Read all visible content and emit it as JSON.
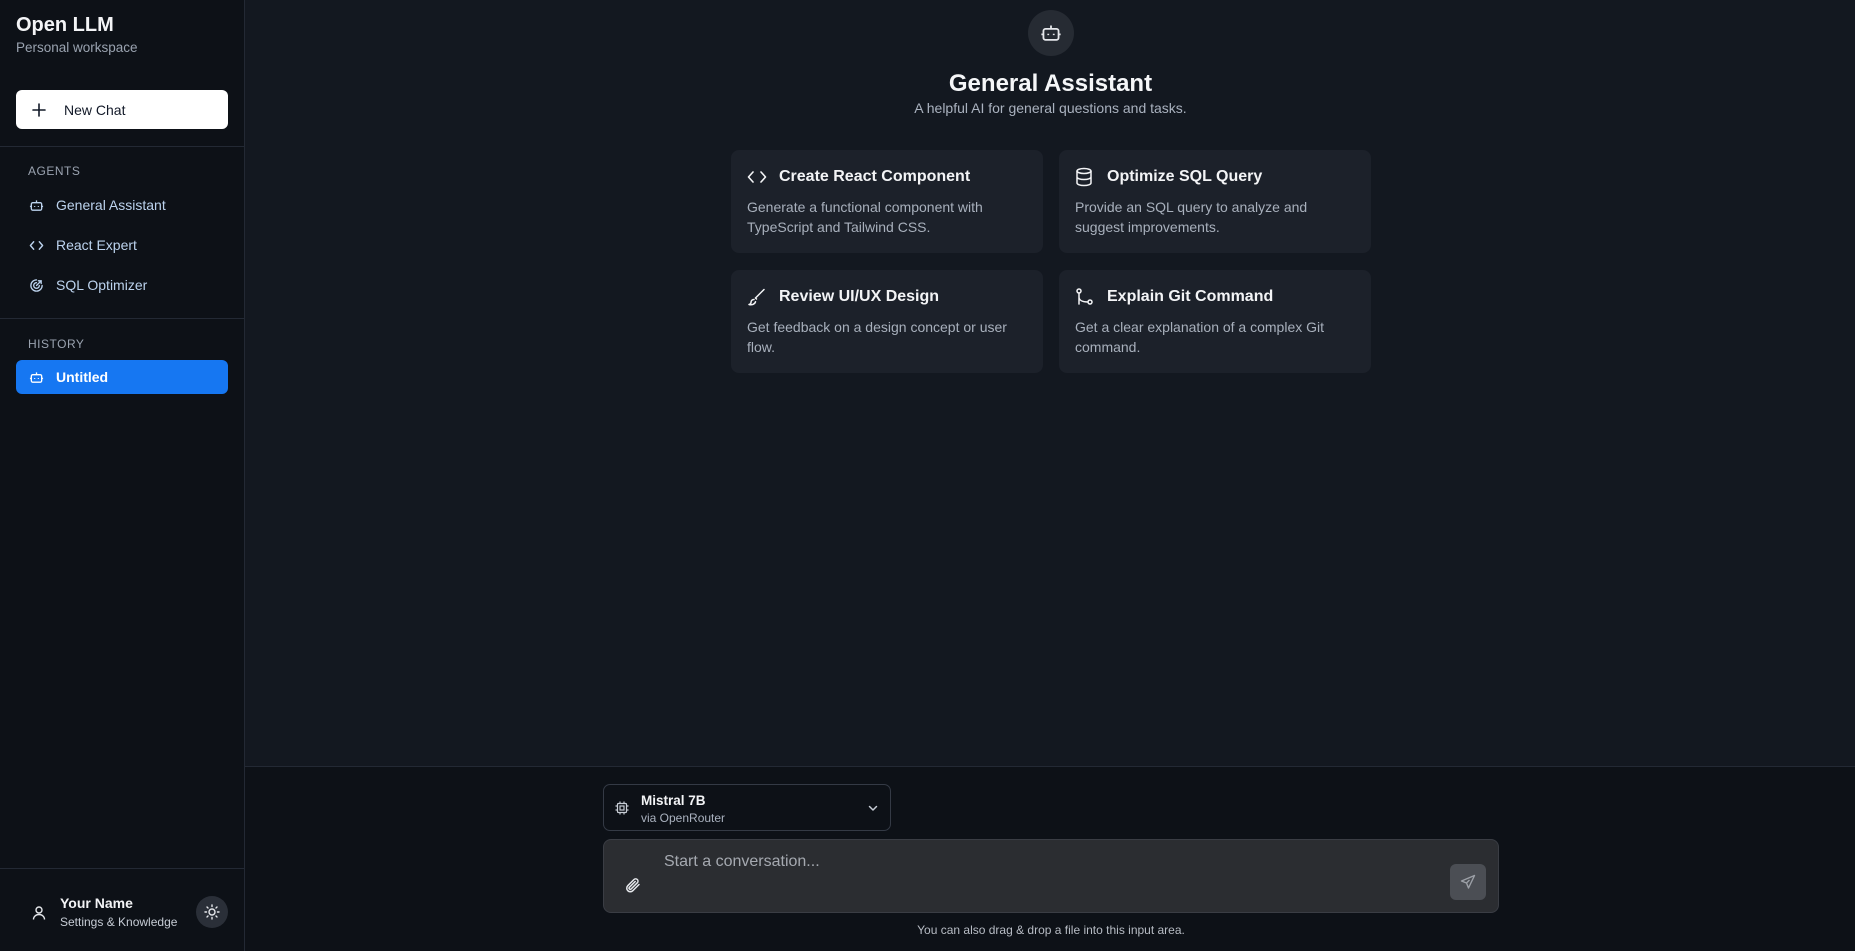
{
  "sidebar": {
    "brand_title": "Open LLM",
    "brand_subtitle": "Personal workspace",
    "new_chat_label": "New Chat",
    "agents_heading": "AGENTS",
    "agents": [
      {
        "label": "General Assistant",
        "icon": "robot-icon"
      },
      {
        "label": "React Expert",
        "icon": "code-icon"
      },
      {
        "label": "SQL Optimizer",
        "icon": "database-gauge-icon"
      }
    ],
    "history_heading": "HISTORY",
    "history": [
      {
        "label": "Untitled",
        "icon": "robot-icon",
        "active": true
      }
    ],
    "user": {
      "name": "Your Name",
      "subtitle": "Settings & Knowledge"
    }
  },
  "main": {
    "agent_title": "General Assistant",
    "agent_description": "A helpful AI for general questions and tasks.",
    "suggestions": [
      {
        "title": "Create React Component",
        "description": "Generate a functional component with TypeScript and Tailwind CSS.",
        "icon": "code-icon"
      },
      {
        "title": "Optimize SQL Query",
        "description": "Provide an SQL query to analyze and suggest improvements.",
        "icon": "database-icon"
      },
      {
        "title": "Review UI/UX Design",
        "description": "Get feedback on a design concept or user flow.",
        "icon": "brush-icon"
      },
      {
        "title": "Explain Git Command",
        "description": "Get a clear explanation of a complex Git command.",
        "icon": "git-branch-icon"
      }
    ]
  },
  "composer": {
    "model_name": "Mistral 7B",
    "model_provider": "via OpenRouter",
    "placeholder": "Start a conversation...",
    "hint": "You can also drag & drop a file into this input area."
  },
  "colors": {
    "accent": "#1677f2",
    "background": "#131820",
    "sidebar": "#0d1117",
    "card": "#1c212a"
  }
}
